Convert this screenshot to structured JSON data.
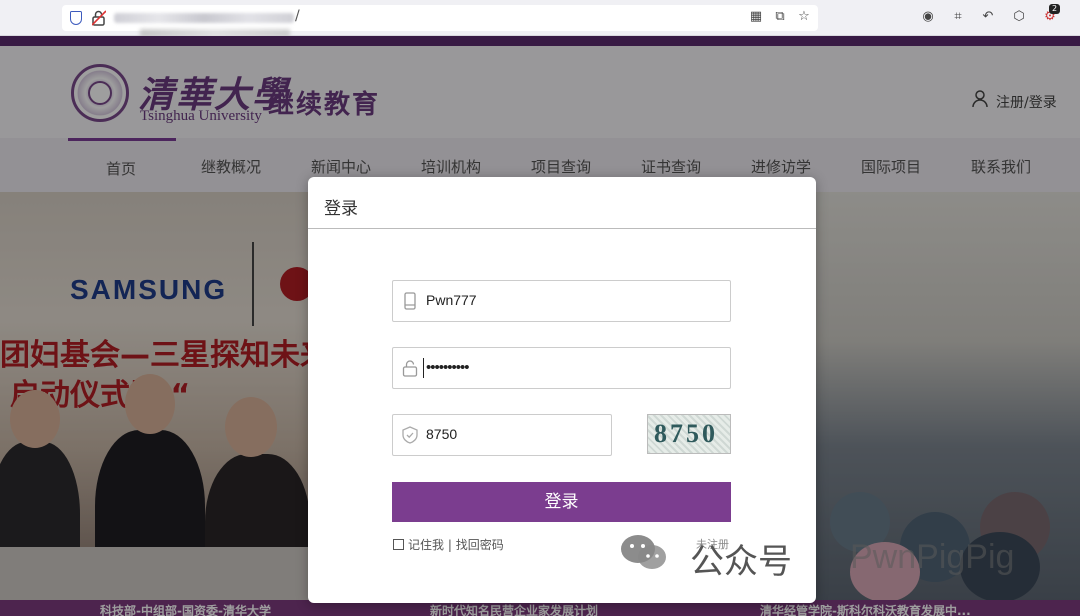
{
  "browser": {
    "url_suffix": "/",
    "badge_count": "2"
  },
  "site": {
    "logo_cn": "清華大學",
    "logo_en": "Tsinghua University",
    "logo_sub": "继续教育",
    "login_link": "注册/登录"
  },
  "nav": {
    "items": [
      {
        "label": "首页"
      },
      {
        "label": "继教概况"
      },
      {
        "label": "新闻中心"
      },
      {
        "label": "培训机构"
      },
      {
        "label": "项目查询"
      },
      {
        "label": "证书查询"
      },
      {
        "label": "进修访学"
      },
      {
        "label": "国际项目"
      },
      {
        "label": "联系我们"
      }
    ]
  },
  "hero": {
    "samsung": "SAMSUNG",
    "banner_line1": "团妇基会—三星探知未来",
    "banner_line2": "启动仪式暨 “",
    "captions": [
      "科技部-中组部-国资委-清华大学",
      "新时代知名民营企业家发展计划",
      "清华经管学院-斯科尔科沃教育发展中..."
    ]
  },
  "login": {
    "title": "登录",
    "username": "Pwn777",
    "password": "••••••••••",
    "captcha_input": "8750",
    "captcha_image_text": "8750",
    "submit_label": "登录",
    "remember_label": "记住我",
    "separator": "|",
    "forgot_label": "找回密码",
    "register_label": "未注册"
  },
  "watermark": {
    "text": "公众号",
    "brand": "PwnPigPig"
  }
}
